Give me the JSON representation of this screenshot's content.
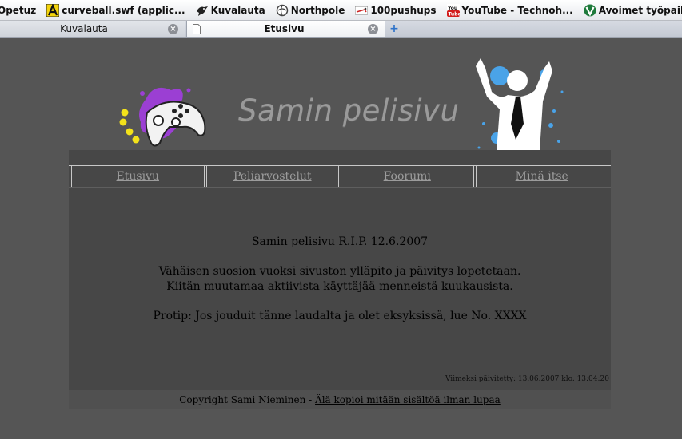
{
  "bookmarks": [
    {
      "label": "Opetuz",
      "icon": "none"
    },
    {
      "label": "curveball.swf (applic...",
      "icon": "letter-a-icon"
    },
    {
      "label": "Kuvalauta",
      "icon": "bird-icon"
    },
    {
      "label": "Northpole",
      "icon": "globe-icon"
    },
    {
      "label": "100pushups",
      "icon": "pushup-icon"
    },
    {
      "label": "YouTube - Technoh...",
      "icon": "youtube-icon"
    },
    {
      "label": "Avoimet työpaikat -...",
      "icon": "v-shield-icon"
    }
  ],
  "tabs": [
    {
      "label": "Kuvalauta",
      "close": "×"
    },
    {
      "label": "Etusivu",
      "close": "×"
    }
  ],
  "new_tab": "+",
  "site": {
    "title": "Samin pelisivu",
    "nav": [
      "Etusivu",
      "Peliarvostelut",
      "Foorumi",
      "Minä itse"
    ],
    "line1": "Samin pelisivu R.I.P. 12.6.2007",
    "line2": "Vähäisen suosion vuoksi sivuston ylläpito ja päivitys lopetetaan.",
    "line3": "Kiitän muutamaa aktiivista käyttäjää menneistä kuukausista.",
    "line4": "Protip: Jos jouduit tänne laudalta ja olet eksyksissä, lue No. XXXX",
    "updated": "Viimeksi päivitetty: 13.06.2007 klo. 13:04:20",
    "footer_text": "Copyright Sami Nieminen - ",
    "footer_link": "Älä kopioi mitään sisältöä ilman lupaa"
  },
  "colors": {
    "page_bg": "#555555",
    "content_bg": "#474747",
    "nav_link": "#9c9c9c",
    "splash_purple": "#9b3fd3",
    "splash_yellow": "#f3e21a",
    "splash_blue": "#4aa3e8"
  }
}
